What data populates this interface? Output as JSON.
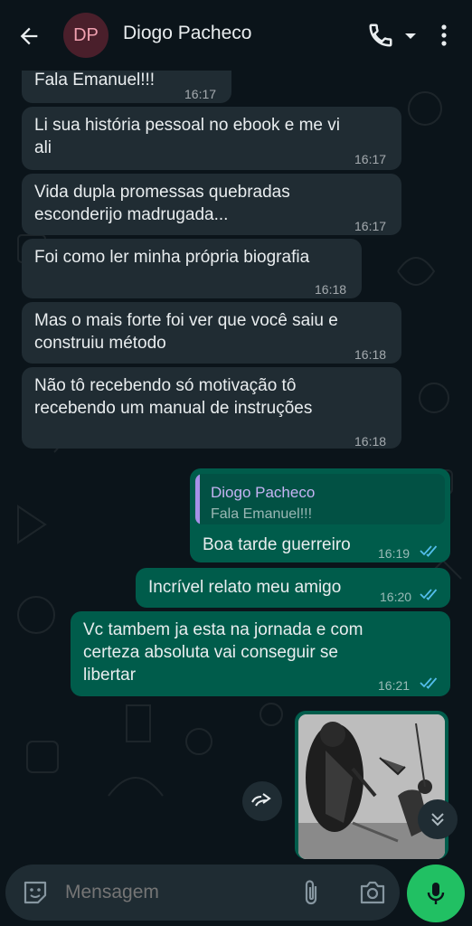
{
  "header": {
    "avatar_initials": "DP",
    "contact_name": "Diogo Pacheco",
    "icons": [
      "back-arrow-icon",
      "phone-icon",
      "dropdown-caret-icon",
      "more-vert-icon"
    ]
  },
  "messages": [
    {
      "dir": "in",
      "lines": [
        "Fala Emanuel!!!"
      ],
      "time": "16:17"
    },
    {
      "dir": "in",
      "lines": [
        "Li sua história pessoal no ebook e me vi",
        "ali"
      ],
      "time": "16:17"
    },
    {
      "dir": "in",
      "lines": [
        "Vida dupla promessas quebradas",
        "esconderijo madrugada..."
      ],
      "time": "16:17"
    },
    {
      "dir": "in",
      "lines": [
        "Foi como ler minha própria biografia"
      ],
      "time": "16:18"
    },
    {
      "dir": "in",
      "lines": [
        "Mas o mais forte foi ver que você saiu e",
        "construiu método"
      ],
      "time": "16:18"
    },
    {
      "dir": "in",
      "lines": [
        "Não tô recebendo só motivação tô",
        "recebendo um manual de instruções"
      ],
      "time": "16:18"
    },
    {
      "dir": "out",
      "quote": {
        "name": "Diogo Pacheco",
        "text": "Fala Emanuel!!!"
      },
      "lines": [
        "Boa tarde guerreiro"
      ],
      "time": "16:19",
      "status": "read"
    },
    {
      "dir": "out",
      "lines": [
        "Incrível relato meu amigo"
      ],
      "time": "16:20",
      "status": "read"
    },
    {
      "dir": "out",
      "lines": [
        "Vc tambem ja esta na jornada e com",
        "certeza absoluta vai conseguir se",
        "libertar"
      ],
      "time": "16:21",
      "status": "read"
    }
  ],
  "image_message": {
    "dir": "out",
    "icon": "image-thumbnail"
  },
  "composer": {
    "placeholder": "Mensagem",
    "icons": [
      "sticker-icon",
      "attach-icon",
      "camera-icon",
      "mic-icon"
    ]
  },
  "colors": {
    "background": "#0b141a",
    "incoming_bubble": "#202c33",
    "outgoing_bubble": "#005c4b",
    "read_tick": "#53bdeb",
    "mic_button": "#21c063",
    "quote_accent": "#a791e8"
  }
}
